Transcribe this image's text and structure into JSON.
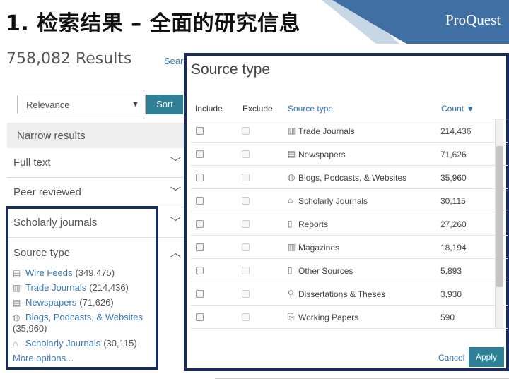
{
  "slide": {
    "title": "1. 检索结果 – 全面的研究信息",
    "logo": "ProQuest"
  },
  "results": {
    "count_text": "758,082 Results",
    "search_link": "Search"
  },
  "sort": {
    "selected": "Relevance",
    "button": "Sort"
  },
  "narrow": {
    "title": "Narrow results",
    "facets": [
      "Full text",
      "Peer reviewed",
      "Scholarly journals",
      "Source type"
    ]
  },
  "facet_list": {
    "items": [
      {
        "icon": "wire-feed-icon",
        "label": "Wire Feeds",
        "count": "(349,475)"
      },
      {
        "icon": "trade-journal-icon",
        "label": "Trade Journals",
        "count": "(214,436)"
      },
      {
        "icon": "newspaper-icon",
        "label": "Newspapers",
        "count": "(71,626)"
      },
      {
        "icon": "globe-icon",
        "label": "Blogs, Podcasts, & Websites",
        "count": "(35,960)"
      },
      {
        "icon": "graduation-cap-icon",
        "label": "Scholarly Journals",
        "count": "(30,115)"
      }
    ],
    "more": "More options..."
  },
  "dialog": {
    "title": "Source type",
    "headers": {
      "include": "Include",
      "exclude": "Exclude",
      "type": "Source type",
      "count": "Count ▼"
    },
    "rows": [
      {
        "icon": "trade-journal-icon",
        "label": "Trade Journals",
        "count": "214,436"
      },
      {
        "icon": "newspaper-icon",
        "label": "Newspapers",
        "count": "71,626"
      },
      {
        "icon": "globe-icon",
        "label": "Blogs, Podcasts, & Websites",
        "count": "35,960"
      },
      {
        "icon": "graduation-cap-icon",
        "label": "Scholarly Journals",
        "count": "30,115"
      },
      {
        "icon": "report-icon",
        "label": "Reports",
        "count": "27,260"
      },
      {
        "icon": "magazine-icon",
        "label": "Magazines",
        "count": "18,194"
      },
      {
        "icon": "document-icon",
        "label": "Other Sources",
        "count": "5,893"
      },
      {
        "icon": "dissertation-icon",
        "label": "Dissertations & Theses",
        "count": "3,930"
      },
      {
        "icon": "working-paper-icon",
        "label": "Working Papers",
        "count": "590"
      }
    ],
    "cancel": "Cancel",
    "apply": "Apply"
  },
  "colors": {
    "accent": "#2e8096",
    "link": "#3a78b5",
    "highlight": "#1b2c5a",
    "header_band": "#3f6fa3"
  }
}
